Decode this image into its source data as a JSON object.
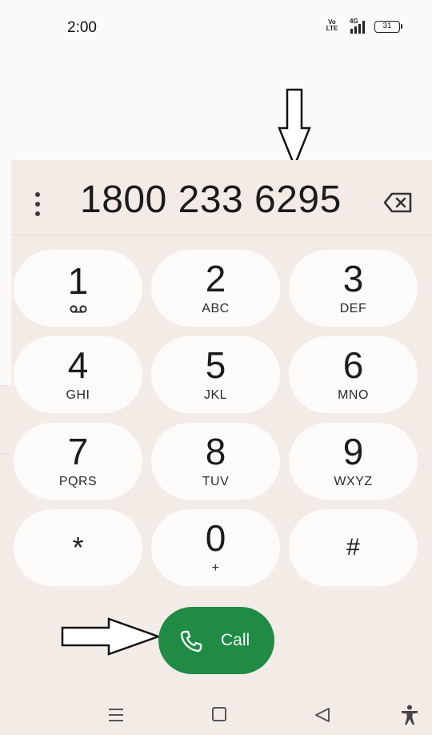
{
  "status_bar": {
    "time": "2:00",
    "network_label": "Vo LTE",
    "signal_label": "4G",
    "battery": "31"
  },
  "dialer": {
    "number": "1800 233 6295",
    "more_icon": "more-vert-icon",
    "backspace_icon": "backspace-icon"
  },
  "keypad": {
    "keys": [
      {
        "digit": "1",
        "letters": "",
        "icon": "voicemail-icon"
      },
      {
        "digit": "2",
        "letters": "ABC"
      },
      {
        "digit": "3",
        "letters": "DEF"
      },
      {
        "digit": "4",
        "letters": "GHI"
      },
      {
        "digit": "5",
        "letters": "JKL"
      },
      {
        "digit": "6",
        "letters": "MNO"
      },
      {
        "digit": "7",
        "letters": "PQRS"
      },
      {
        "digit": "8",
        "letters": "TUV"
      },
      {
        "digit": "9",
        "letters": "WXYZ"
      },
      {
        "digit": "*",
        "letters": ""
      },
      {
        "digit": "0",
        "letters": "+"
      },
      {
        "digit": "#",
        "letters": ""
      }
    ]
  },
  "call": {
    "label": "Call",
    "icon": "phone-icon",
    "color": "#1f8b45"
  },
  "nav": {
    "icons": [
      "menu-icon",
      "home-icon",
      "back-icon",
      "accessibility-icon"
    ]
  },
  "colors": {
    "background": "#f3ece6",
    "key": "#fdfbf9",
    "top_area": "#fcfaf8"
  }
}
